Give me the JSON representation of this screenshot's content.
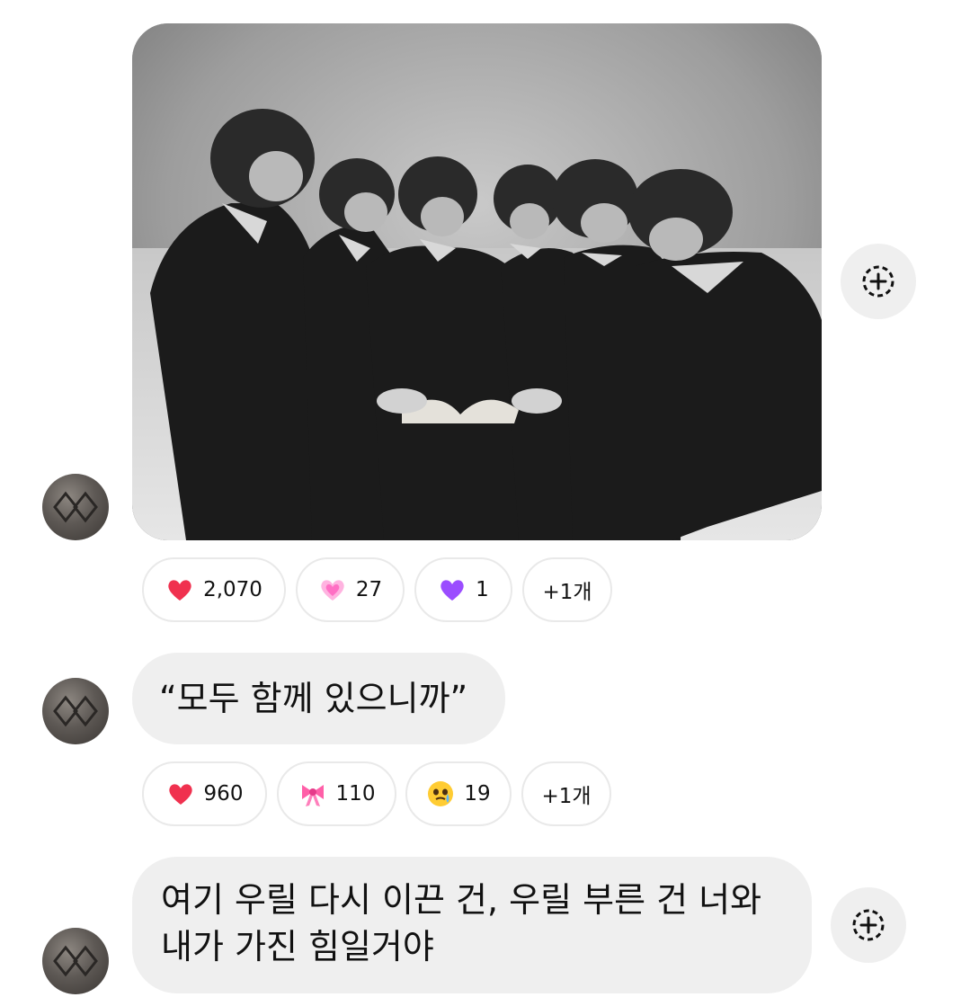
{
  "messages": [
    {
      "type": "image",
      "reactions": [
        {
          "icon": "red-heart-icon",
          "count": "2,070"
        },
        {
          "icon": "growing-heart-icon",
          "count": "27"
        },
        {
          "icon": "purple-heart-icon",
          "count": "1"
        },
        {
          "more": "+1개"
        }
      ]
    },
    {
      "type": "text",
      "text": "“모두 함께 있으니까”",
      "reactions": [
        {
          "icon": "red-heart-icon",
          "count": "960"
        },
        {
          "icon": "ribbon-icon",
          "count": "110"
        },
        {
          "icon": "face-holding-back-tears-icon",
          "count": "19"
        },
        {
          "more": "+1개"
        }
      ]
    },
    {
      "type": "text",
      "lines": [
        "여기 우릴 다시 이끈 건, 우릴 부른 건 너와",
        "내가 가진 힘일거야"
      ]
    }
  ],
  "colors": {
    "bubble": "#efefef",
    "chip_border": "#e9e9e9",
    "heart_red": "#f0314f",
    "heart_pink": "#ff6fc4",
    "heart_purple": "#9b4dff"
  }
}
